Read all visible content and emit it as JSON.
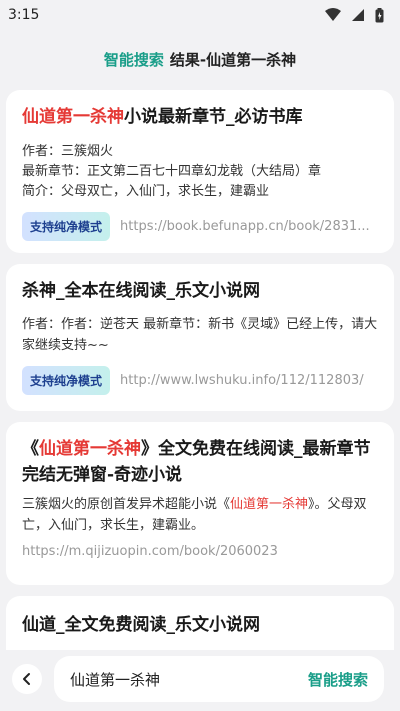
{
  "status": {
    "time": "3:15",
    "icons": [
      "wifi-icon",
      "signal-icon",
      "battery-icon"
    ]
  },
  "header": {
    "brand": "智能搜索",
    "title": "结果-仙道第一杀神"
  },
  "results": [
    {
      "title_hl": "仙道第一杀神",
      "title_rest": "小说最新章节_必访书库",
      "author": "作者：三簇烟火",
      "latest": "最新章节：正文第二百七十四章幻龙戟（大结局）章",
      "summary": "简介：父母双亡，入仙门，求长生，建霸业",
      "badge": "支持纯净模式",
      "url": "https://book.befunapp.cn/book/2831..."
    },
    {
      "title": "杀神_全本在线阅读_乐文小说网",
      "desc": "作者：作者：逆苍天 最新章节：新书《灵域》已经上传，请大家继续支持~~",
      "badge": "支持纯净模式",
      "url": "http://www.lwshuku.info/112/112803/"
    },
    {
      "title_pre": "《",
      "title_hl": "仙道第一杀神",
      "title_rest": "》全文免费在线阅读_最新章节完结无弹窗-奇迹小说",
      "desc_pre": "三簇烟火的原创首发异术超能小说《",
      "desc_hl": "仙道第一杀神",
      "desc_rest": "》。父母双亡，入仙门，求长生，建霸业。",
      "url": "https://m.qijizuopin.com/book/2060023"
    },
    {
      "title": "仙道_全文免费阅读_乐文小说网"
    }
  ],
  "bottom": {
    "query": "仙道第一杀神",
    "search_label": "智能搜索"
  },
  "colors": {
    "accent": "#1a9e89",
    "highlight": "#e53935"
  }
}
